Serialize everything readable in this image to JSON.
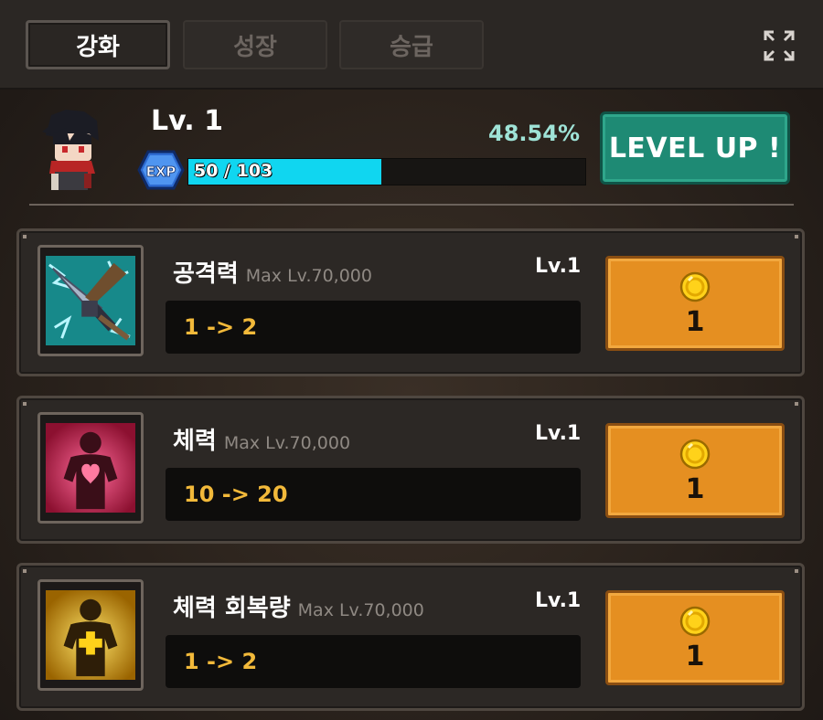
{
  "tabs": [
    {
      "label": "강화",
      "active": true
    },
    {
      "label": "성장",
      "active": false
    },
    {
      "label": "승급",
      "active": false
    }
  ],
  "icons": {
    "expand": "expand-icon",
    "exp_badge": "exp-badge-icon",
    "coin": "coin-icon"
  },
  "header": {
    "level": "Lv. 1",
    "percent": "48.54%",
    "exp_label": "EXP",
    "exp_text": "50 / 103",
    "exp_progress": 0.4854,
    "level_up_label": "LEVEL UP !"
  },
  "stats": [
    {
      "name": "공격력",
      "max": "Max Lv.70,000",
      "level": "Lv.1",
      "value": "1 -> 2",
      "cost": "1",
      "icon": "sword-icon"
    },
    {
      "name": "체력",
      "max": "Max Lv.70,000",
      "level": "Lv.1",
      "value": "10 -> 20",
      "cost": "1",
      "icon": "heart-body-icon"
    },
    {
      "name": "체력 회복량",
      "max": "Max Lv.70,000",
      "level": "Lv.1",
      "value": "1 -> 2",
      "cost": "1",
      "icon": "health-regen-icon"
    }
  ],
  "colors": {
    "accent_teal": "#1e8a74",
    "exp_fill": "#10d6f0",
    "buy_orange": "#e58f21",
    "value_gold": "#f2b93a"
  }
}
